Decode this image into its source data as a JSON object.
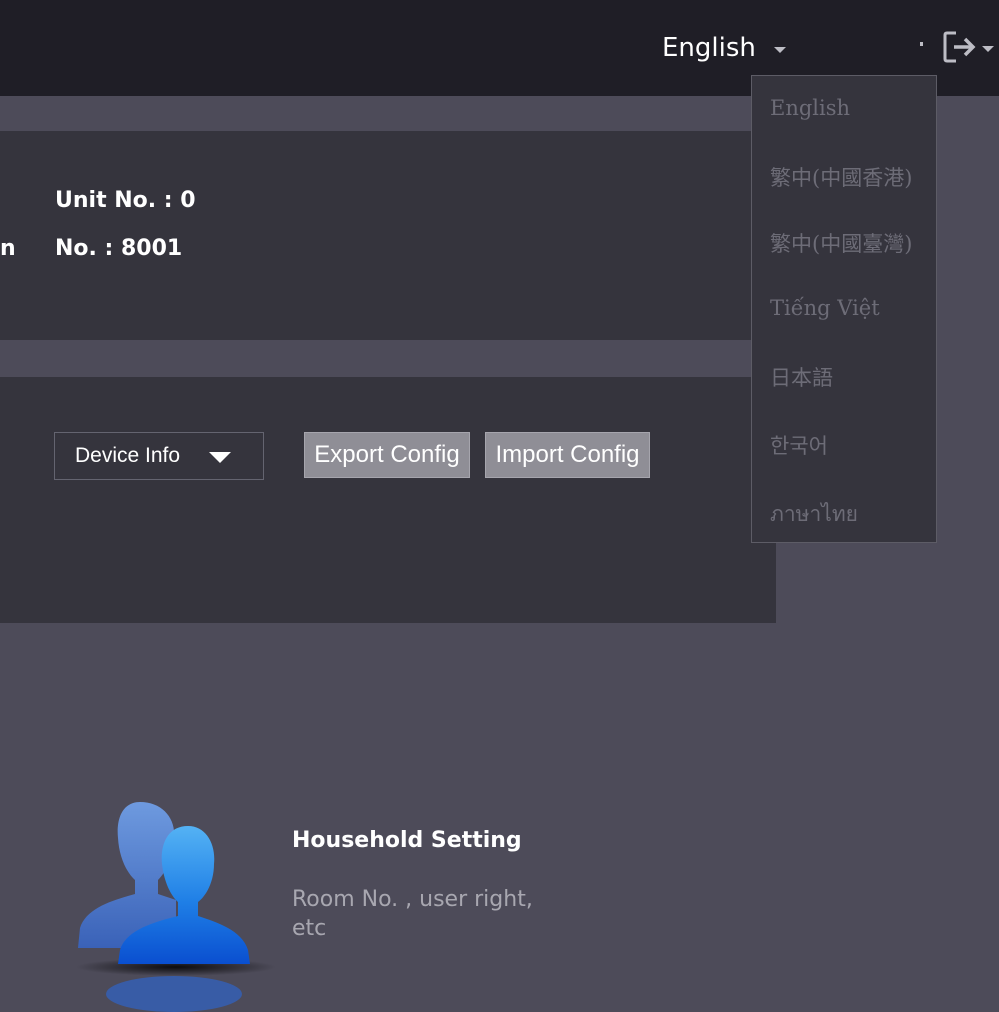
{
  "header": {
    "language_selected": "English",
    "icons": {
      "logout": "logout-icon",
      "caret": "caret-down-icon"
    }
  },
  "info_panel": {
    "unit_label": "Unit No. : 0",
    "room_label_partial": "n",
    "no_label": "No. : 8001"
  },
  "config_panel": {
    "select_value": "Device Info",
    "export_button": "Export Config",
    "import_button": "Import Config"
  },
  "language_menu": {
    "items": [
      "English",
      "繁中(中國香港)",
      "繁中(中國臺灣)",
      "Tiếng Việt",
      "日本語",
      "한국어",
      "ภาษาไทย"
    ]
  },
  "household": {
    "title": "Household Setting",
    "description": "Room No. , user right, etc",
    "icon": "users-icon"
  },
  "colors": {
    "topbar": "#1f1e26",
    "background": "#4d4b59",
    "panel": "#35343d",
    "button": "#8f8e96",
    "menu_text": "#6d6c77",
    "icon_blue": "#2a7be0"
  }
}
